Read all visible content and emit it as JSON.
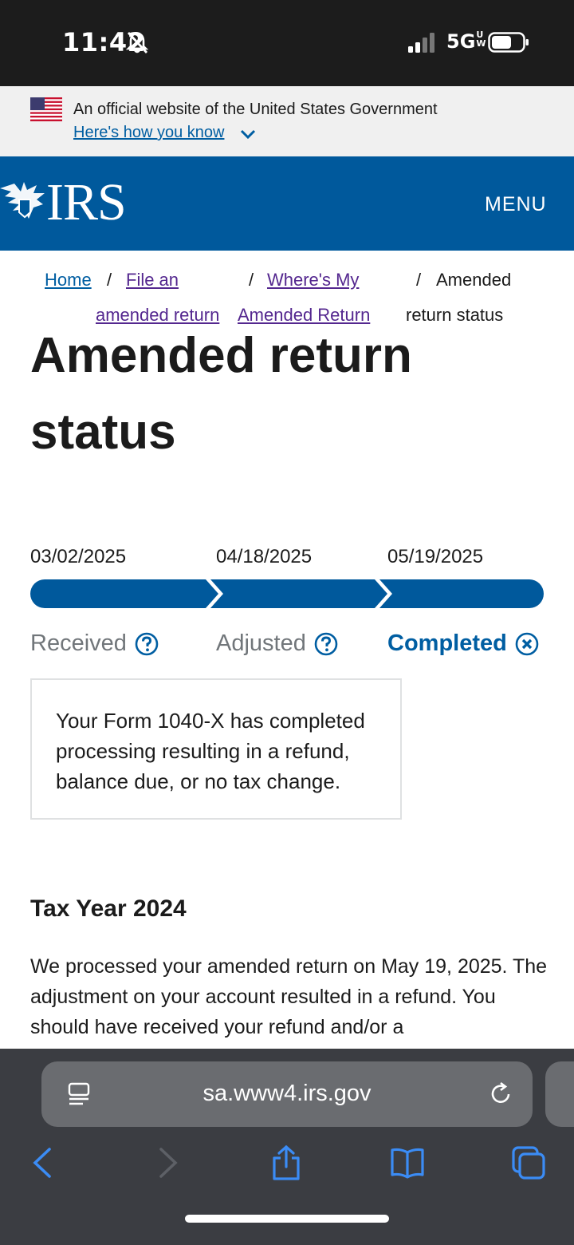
{
  "status_bar": {
    "time": "11:42",
    "network": "5GUW"
  },
  "gov_banner": {
    "text": "An official website of the United States Government",
    "link": "Here's how you know"
  },
  "header": {
    "logo": "IRS",
    "menu_label": "MENU"
  },
  "breadcrumb": {
    "home": "Home",
    "item1_line1": "File an",
    "item1_line2": "amended return",
    "item2_line1": "Where's My",
    "item2_line2": "Amended Return",
    "current_line1": "Amended",
    "current_line2": "return status",
    "separator": "/"
  },
  "page_title": "Amended return status",
  "tracker": {
    "steps": [
      {
        "date": "03/02/2025",
        "label": "Received",
        "state": "complete"
      },
      {
        "date": "04/18/2025",
        "label": "Adjusted",
        "state": "complete"
      },
      {
        "date": "05/19/2025",
        "label": "Completed",
        "state": "current"
      }
    ],
    "status_message": "Your Form 1040-X has completed processing resulting in a refund, balance due, or no tax change."
  },
  "tax_year": {
    "heading": "Tax Year 2024",
    "body": "We processed your amended return on May 19, 2025. The adjustment on your account resulted in a refund. You should have received your refund and/or a"
  },
  "browser": {
    "url": "sa.www4.irs.gov"
  },
  "colors": {
    "irs_blue": "#00599c",
    "link_blue": "#005ea2",
    "visited_purple": "#54278f",
    "muted_gray": "#71767a"
  }
}
